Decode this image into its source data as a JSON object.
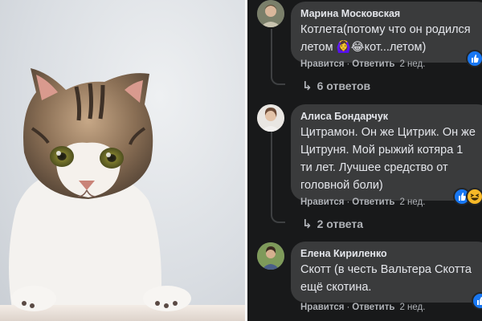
{
  "comments": [
    {
      "author": "Марина Московская",
      "lines": [
        "Котлета(потому что он родился",
        "летом 🙆‍♀️😂кот...летом)"
      ],
      "like_label": "Нравится",
      "reply_label": "Ответить",
      "time": "2 нед.",
      "reactions": [
        "like"
      ],
      "replies_label": "6 ответов"
    },
    {
      "author": "Алиса Бондарчук",
      "lines": [
        "Цитрамон. Он же Цитрик. Он же",
        "Цитруня. Мой рыжий котяра 1",
        "ти лет. Лучшее средство от",
        "головной боли)"
      ],
      "like_label": "Нравится",
      "reply_label": "Ответить",
      "time": "2 нед.",
      "reactions": [
        "like",
        "haha"
      ],
      "replies_label": "2 ответа"
    },
    {
      "author": "Елена Кириленко",
      "lines": [
        "Скотт (в честь Вальтера Скотта",
        "ещё скотина."
      ],
      "like_label": "Нравится",
      "reply_label": "Ответить",
      "time": "2 нед.",
      "reactions": [
        "like"
      ]
    }
  ],
  "colors": {
    "background": "#18191a",
    "bubble": "#3a3b3c",
    "text": "#e4e6eb",
    "secondary_text": "#b0b3b8",
    "like_reaction": "#1877f2",
    "haha_reaction": "#f7b928"
  },
  "icons": {
    "reply_arrow": "reply-arrow-icon",
    "like": "like-reaction-icon",
    "haha": "haha-reaction-icon"
  }
}
